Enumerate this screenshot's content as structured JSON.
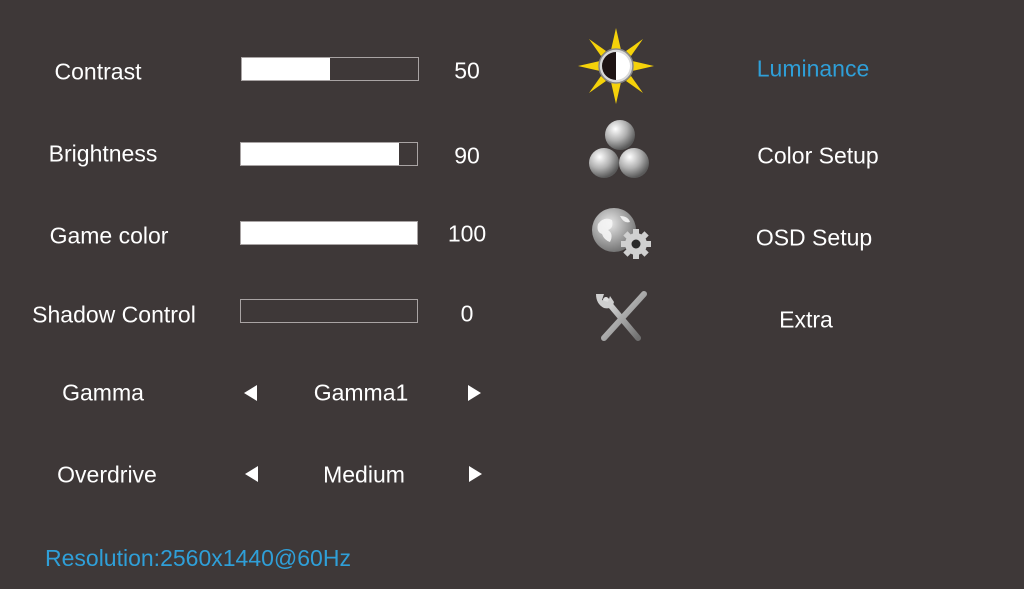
{
  "settings": [
    {
      "label": "Contrast",
      "type": "slider",
      "value": "50",
      "fraction": 0.5
    },
    {
      "label": "Brightness",
      "type": "slider",
      "value": "90",
      "fraction": 0.9
    },
    {
      "label": "Game color",
      "type": "slider",
      "value": "100",
      "fraction": 1.0
    },
    {
      "label": "Shadow Control",
      "type": "slider",
      "value": "0",
      "fraction": 0.0
    },
    {
      "label": "Gamma",
      "type": "selector",
      "value": "Gamma1"
    },
    {
      "label": "Overdrive",
      "type": "selector",
      "value": "Medium"
    }
  ],
  "menu": [
    {
      "label": "Luminance",
      "icon": "sun-contrast-icon",
      "active": true
    },
    {
      "label": "Color Setup",
      "icon": "color-spheres-icon",
      "active": false
    },
    {
      "label": "OSD Setup",
      "icon": "globe-gear-icon",
      "active": false
    },
    {
      "label": "Extra",
      "icon": "tools-icon",
      "active": false
    }
  ],
  "status": {
    "resolution": "Resolution:2560x1440@60Hz"
  },
  "colors": {
    "background": "#3e3838",
    "active": "#2f9fd8",
    "text": "#ffffff",
    "sun": "#f5d20a"
  }
}
